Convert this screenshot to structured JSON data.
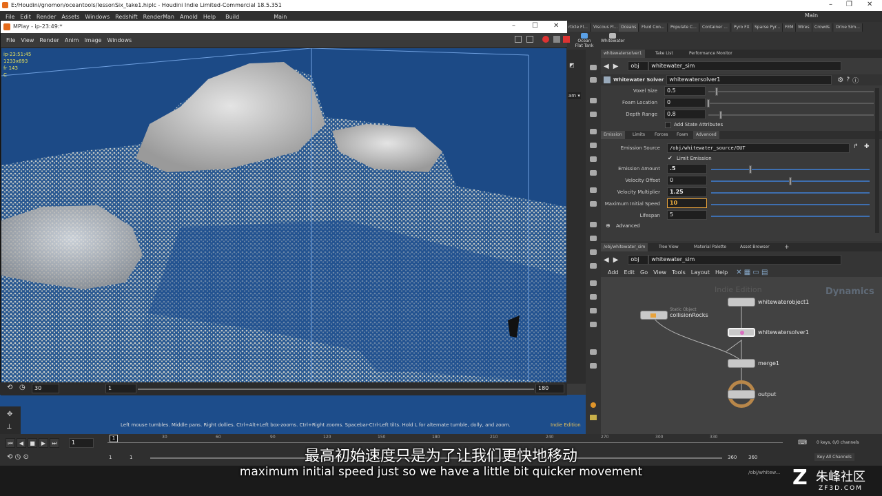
{
  "window": {
    "title": "E:/Houdini/gnomon/oceantools/lessonSix_take1.hiplc - Houdini Indie Limited-Commercial 18.5.351"
  },
  "menubar": {
    "items": [
      "File",
      "Edit",
      "Render",
      "Assets",
      "Windows",
      "Redshift",
      "RenderMan",
      "Arnold",
      "Help"
    ],
    "build": "Build",
    "main": "Main",
    "right_desk": "Main"
  },
  "shelf": {
    "tabs": [
      "rticle Fl...",
      "Viscous Fl...",
      "Oceans",
      "Fluid Con...",
      "Populate C...",
      "Container ...",
      "Pyro FX",
      "Sparse Pyr...",
      "FEM",
      "Wires",
      "Crowds",
      "Drive Sim..."
    ],
    "tools": [
      "Ocean Flat Tank",
      "Whitewater"
    ]
  },
  "mplay": {
    "title": "MPlay - ip-23:49:*",
    "menu": [
      "File",
      "View",
      "Render",
      "Anim",
      "Image",
      "Windows"
    ],
    "overlay": [
      "ip-23:51:45",
      "1233x693",
      "fr 143",
      "C"
    ],
    "frame": "143",
    "frame_marker": "143",
    "fps": "30",
    "range_start": "1",
    "range_end": "180",
    "ticks": [
      "30",
      "60",
      "90",
      "120",
      "150"
    ]
  },
  "params": {
    "tabs": [
      "whitewatersolver1",
      "Take List",
      "Performance Monitor"
    ],
    "path_obj": "obj",
    "path_node": "whitewater_sim",
    "node_type": "Whitewater Solver",
    "node_name": "whitewatersolver1",
    "voxel_size_label": "Voxel Size",
    "voxel_size": "0.5",
    "foam_loc_label": "Foam Location",
    "foam_loc": "0",
    "depth_label": "Depth Range",
    "depth": "0.8",
    "add_state": "Add State Attributes",
    "subtabs": [
      "Emission",
      "Limits",
      "Forces",
      "Foam",
      "Advanced"
    ],
    "emission_source_label": "Emission Source",
    "emission_source": "/obj/whitewater_source/OUT",
    "limit_emission": "Limit Emission",
    "emission_amount_label": "Emission Amount",
    "emission_amount": ".5",
    "vel_offset_label": "Velocity Offset",
    "vel_offset": "0",
    "vel_mult_label": "Velocity Multiplier",
    "vel_mult": "1.25",
    "max_speed_label": "Maximum Initial Speed",
    "max_speed": "10",
    "lifespan_label": "Lifespan",
    "lifespan": "5",
    "advanced": "Advanced"
  },
  "network": {
    "tabs": [
      "/obj/whitewater_sim",
      "Tree View",
      "Material Palette",
      "Asset Browser"
    ],
    "path_obj": "obj",
    "path_node": "whitewater_sim",
    "menu": [
      "Add",
      "Edit",
      "Go",
      "View",
      "Tools",
      "Layout",
      "Help"
    ],
    "watermark": "Indie Edition",
    "context": "Dynamics",
    "nodes": {
      "static_type": "Static Object",
      "static": "collisionRocks",
      "obj": "whitewaterobject1",
      "solver": "whitewatersolver1",
      "merge": "merge1",
      "output": "output"
    }
  },
  "viewport": {
    "hint": "Left mouse tumbles. Middle pans. Right dollies. Ctrl+Alt+Left box-zooms. Ctrl+Right zooms. Spacebar-Ctrl-Left tilts. Hold L for alternate tumble, dolly, and zoom.",
    "indie": "Indie Edition"
  },
  "timeline": {
    "frame": "1",
    "start": "1",
    "start2": "1",
    "end": "360",
    "end2": "360",
    "ticks": [
      "30",
      "60",
      "90",
      "120",
      "150",
      "180",
      "210",
      "240",
      "270",
      "300",
      "330"
    ],
    "keys": "0 keys, 0/0 channels",
    "key_all": "Key All Channels"
  },
  "subtitles": {
    "cn": "最高初始速度只是为了让我们更快地移动",
    "en": "maximum initial speed just so we have a little bit quicker movement"
  },
  "brand": {
    "name": "朱峰社区",
    "url": "ZF3D.COM",
    "path": "/obj/whitew..."
  }
}
